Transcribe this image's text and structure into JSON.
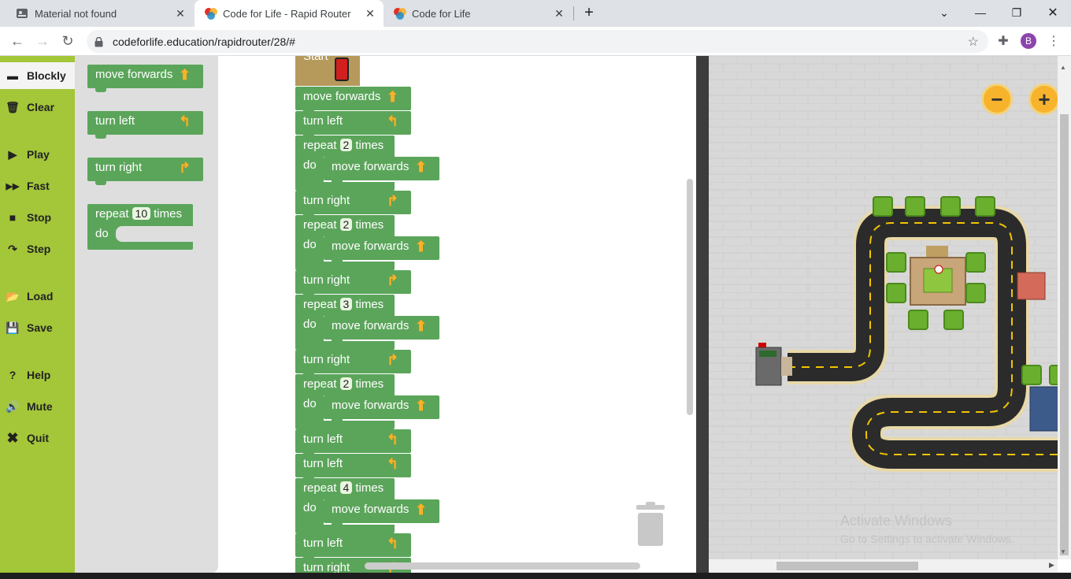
{
  "browser": {
    "tabs": [
      {
        "title": "Material not found",
        "active": false
      },
      {
        "title": "Code for Life - Rapid Router",
        "active": true
      },
      {
        "title": "Code for Life",
        "active": false
      }
    ],
    "url": "codeforlife.education/rapidrouter/28/#",
    "profile_initial": "B"
  },
  "nav": {
    "items": [
      {
        "label": "Blockly",
        "icon": "blockly-icon",
        "active": true
      },
      {
        "label": "Clear",
        "icon": "trash-icon"
      },
      {
        "label": "Play",
        "icon": "play-icon"
      },
      {
        "label": "Fast",
        "icon": "fast-forward-icon"
      },
      {
        "label": "Stop",
        "icon": "stop-icon"
      },
      {
        "label": "Step",
        "icon": "step-icon"
      },
      {
        "label": "Load",
        "icon": "folder-icon"
      },
      {
        "label": "Save",
        "icon": "save-icon"
      },
      {
        "label": "Help",
        "icon": "help-icon"
      },
      {
        "label": "Mute",
        "icon": "speaker-icon"
      },
      {
        "label": "Quit",
        "icon": "close-icon"
      }
    ]
  },
  "flyout": {
    "move_forwards": "move forwards",
    "turn_left": "turn left",
    "turn_right": "turn right",
    "repeat_label": "repeat",
    "repeat_count": "10",
    "times_label": "times",
    "do_label": "do"
  },
  "program": {
    "start_label": "Start",
    "blocks": [
      {
        "type": "move",
        "label": "move forwards"
      },
      {
        "type": "left",
        "label": "turn left"
      },
      {
        "type": "repeat",
        "count": "2",
        "inner": "move forwards"
      },
      {
        "type": "right",
        "label": "turn right"
      },
      {
        "type": "repeat",
        "count": "2",
        "inner": "move forwards"
      },
      {
        "type": "right",
        "label": "turn right"
      },
      {
        "type": "repeat",
        "count": "3",
        "inner": "move forwards"
      },
      {
        "type": "right",
        "label": "turn right"
      },
      {
        "type": "repeat",
        "count": "2",
        "inner": "move forwards"
      },
      {
        "type": "left",
        "label": "turn left"
      },
      {
        "type": "left",
        "label": "turn left"
      },
      {
        "type": "repeat",
        "count": "4",
        "inner": "move forwards"
      },
      {
        "type": "left",
        "label": "turn left"
      },
      {
        "type": "right",
        "label": "turn right"
      }
    ],
    "repeat_label": "repeat",
    "times_label": "times",
    "do_label": "do"
  },
  "map": {
    "zoom_out": "−",
    "zoom_in": "+",
    "watermark_title": "Activate Windows",
    "watermark_sub": "Go to Settings to activate Windows."
  },
  "colors": {
    "nav_green": "#a4c639",
    "block_green": "#5ba55b",
    "arrow_yellow": "#f7b32b"
  }
}
